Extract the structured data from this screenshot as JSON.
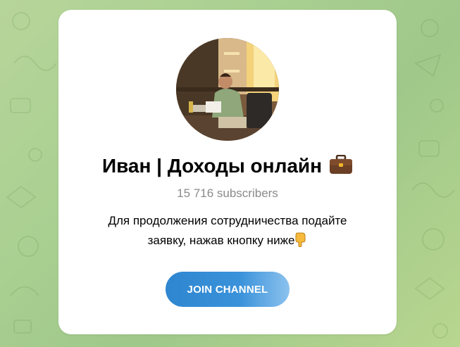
{
  "channel": {
    "title": "Иван | Доходы онлайн",
    "title_emoji": "briefcase-icon",
    "subscribers": "15 716 subscribers",
    "description_line1": "Для продолжения сотрудничества подайте",
    "description_line2": "заявку, нажав кнопку ниже",
    "description_emoji": "pointing-down-hand-icon"
  },
  "actions": {
    "join_label": "JOIN CHANNEL"
  },
  "colors": {
    "accent": "#2f86d0",
    "background": "#a9cf91",
    "muted_text": "#8a8a8a"
  }
}
